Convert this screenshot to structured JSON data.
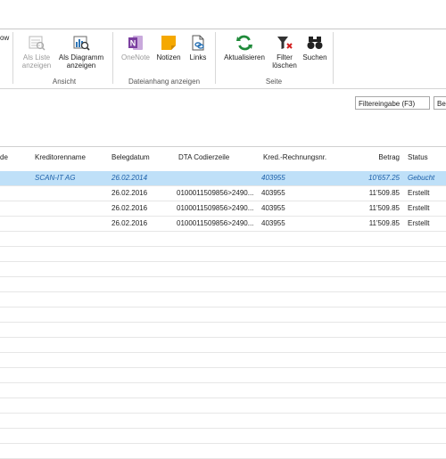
{
  "ribbon": {
    "cut_label": "ow",
    "buttons": {
      "als_liste": "Als Liste anzeigen",
      "als_diagramm": "Als Diagramm anzeigen",
      "onenote": "OneNote",
      "notizen": "Notizen",
      "links": "Links",
      "aktualisieren": "Aktualisieren",
      "filter_loeschen": "Filter löschen",
      "suchen": "Suchen"
    },
    "groups": {
      "ansicht": "Ansicht",
      "dateianhang": "Dateianhang anzeigen",
      "seite": "Seite"
    }
  },
  "filter": {
    "label": "Filtereingabe (F3)",
    "field_cut": "Be"
  },
  "grid": {
    "columns": [
      "de",
      "Kreditorenname",
      "Belegdatum",
      "DTA Codierzeile",
      "Kred.-Rechnungsnr.",
      "Betrag",
      "Status"
    ],
    "rows": [
      {
        "name": "SCAN-IT AG",
        "date": "26.02.2014",
        "dta": "",
        "nr": "403955",
        "betrag": "10'657.25",
        "status": "Gebucht"
      },
      {
        "name": "",
        "date": "26.02.2016",
        "dta": "0100011509856>2490...",
        "nr": "403955",
        "betrag": "11'509.85",
        "status": "Erstellt"
      },
      {
        "name": "",
        "date": "26.02.2016",
        "dta": "0100011509856>2490...",
        "nr": "403955",
        "betrag": "11'509.85",
        "status": "Erstellt"
      },
      {
        "name": "",
        "date": "26.02.2016",
        "dta": "0100011509856>2490...",
        "nr": "403955",
        "betrag": "11'509.85",
        "status": "Erstellt"
      }
    ]
  },
  "colors": {
    "selected_row_bg": "#bfe0f8",
    "selected_row_text": "#1c5fa8",
    "onenote_purple": "#7b3fa0",
    "notizen_yellow": "#f5a800",
    "aktualisieren_green": "#1f8a3a"
  }
}
